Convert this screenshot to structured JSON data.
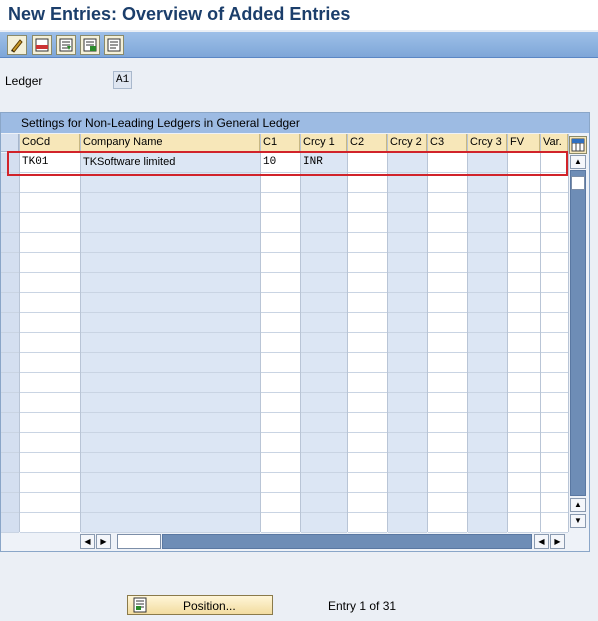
{
  "window": {
    "title": "New Entries: Overview of Added Entries"
  },
  "toolbar": {
    "buttons": [
      {
        "icon": "edit-pencil-icon"
      },
      {
        "icon": "new-entry-icon"
      },
      {
        "icon": "copy-entry-icon"
      },
      {
        "icon": "delete-entry-icon"
      },
      {
        "icon": "select-block-icon"
      }
    ]
  },
  "ledger": {
    "label": "Ledger",
    "value": "A1"
  },
  "table": {
    "title": "Settings for Non-Leading Ledgers in General Ledger",
    "columns": [
      "CoCd",
      "Company Name",
      "C1",
      "Crcy 1",
      "C2",
      "Crcy 2",
      "C3",
      "Crcy 3",
      "FV",
      "Var."
    ],
    "rows": [
      [
        "TK01",
        "TKSoftware limited",
        "10",
        "INR",
        "",
        "",
        "",
        "",
        "",
        ""
      ]
    ]
  },
  "footer": {
    "position_button": "Position...",
    "entry_text": "Entry 1 of 31"
  },
  "colors": {
    "title": "#1b3e6b",
    "toolbar": "#9ec0e8",
    "table_header": "#9dbbe3",
    "column_header": "#f7e7b9",
    "highlight": "#d1232a"
  }
}
